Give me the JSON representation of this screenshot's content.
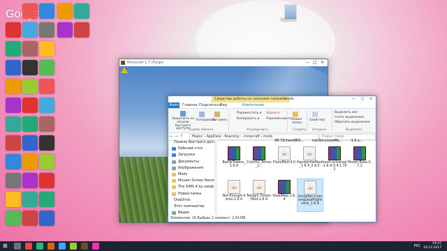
{
  "desktop": {
    "google_logo": "Google",
    "recycle_bin_label": "Корзина"
  },
  "minecraft": {
    "title": "Minecraft 1.7 (Forge)",
    "controls": [
      "—",
      "□",
      "✕"
    ]
  },
  "explorer": {
    "context_tab": "Средства работы со сжатыми папками",
    "window_title": "mods",
    "window_controls": "— □ ✕",
    "tabs": {
      "file": "Файл",
      "home": "Главная",
      "share": "Поделиться",
      "view": "Вид",
      "extract": "Извлечение"
    },
    "ribbon": {
      "pin": "Закрепить на панели быстрого доступа",
      "copy": "Копировать",
      "paste": "Вставить",
      "clipboard_group": "Буфер обмена",
      "move_to": "Переместить в",
      "copy_to": "Копировать в",
      "delete": "Удалить",
      "rename": "Переименовать",
      "organize_group": "Упорядочить",
      "new_folder": "Новая папка",
      "new_group": "Создать",
      "properties": "Свойства",
      "open_group": "Открыть",
      "select_all": "Выделить все",
      "select_none": "Снять выделение",
      "invert": "Обратить выделение",
      "select_group": "Выделить"
    },
    "address": {
      "path": "Маркс  ›  AppData  ›  Roaming  ›  .minecraft  ›  mods",
      "search_placeholder": "Поиск: mods"
    },
    "nav_pane": [
      {
        "label": "Панель быстрого доступа",
        "color": "#4a90d9",
        "header": true
      },
      {
        "label": "Рабочий стол",
        "color": "#3b7dd8"
      },
      {
        "label": "Загрузки",
        "color": "#3b7dd8"
      },
      {
        "label": "Документы",
        "color": "#8a9bb0"
      },
      {
        "label": "Изображения",
        "color": "#8a9bb0"
      },
      {
        "label": "Mods",
        "color": "#e8c35a"
      },
      {
        "label": "Movavi Screen Recorder",
        "color": "#e8c35a"
      },
      {
        "label": "The SIMS 4 by xatab",
        "color": "#e8c35a"
      },
      {
        "label": "Новая папка",
        "color": "#e8c35a"
      },
      {
        "label": "OneDrive",
        "color": "#2a7de1",
        "header": true
      },
      {
        "label": "Этот компьютер",
        "color": "#5a8fd0",
        "header": true
      },
      {
        "label": "Видео",
        "color": "#8a9bb0"
      }
    ],
    "top_row_labels": [
      "VE-7ZchestNPG...",
      "ironStructureMo...",
      "-1.6.x..."
    ],
    "files": [
      {
        "name": "BattleTowers_1.6.4",
        "type": "rar"
      },
      {
        "name": "Colorful_Armor_1...",
        "type": "rar"
      },
      {
        "name": "FlansMod-4.0",
        "type": "jar"
      },
      {
        "name": "HandstrikeMod_1.6.4_2.4.5",
        "type": "jar"
      },
      {
        "name": "hexif-universal-1.6.4-3.4.1.702",
        "type": "rar"
      },
      {
        "name": "Morph-Beta-0.7.2",
        "type": "rar"
      },
      {
        "name": "Not-Enough-Items-1.6.4",
        "type": "jar"
      },
      {
        "name": "Twilight Forest-Mod-1.6.4",
        "type": "jar"
      },
      {
        "name": "VoxelMap 1.6.4",
        "type": "rar"
      },
      {
        "name": "[minefan.ru]moreGoodFlightsOre_1.6.4",
        "type": "jar",
        "selected": true
      }
    ],
    "status": "Элементов: 16     Выбран 1 элемент: 2,94 МБ"
  },
  "taskbar": {
    "start": "⊞",
    "lang": "РУС",
    "time": "19:47",
    "date": "29.12.2017"
  },
  "colors": {
    "accent": "#1979ca",
    "selection": "#cce8ff",
    "taskbar": "#1c2533"
  }
}
